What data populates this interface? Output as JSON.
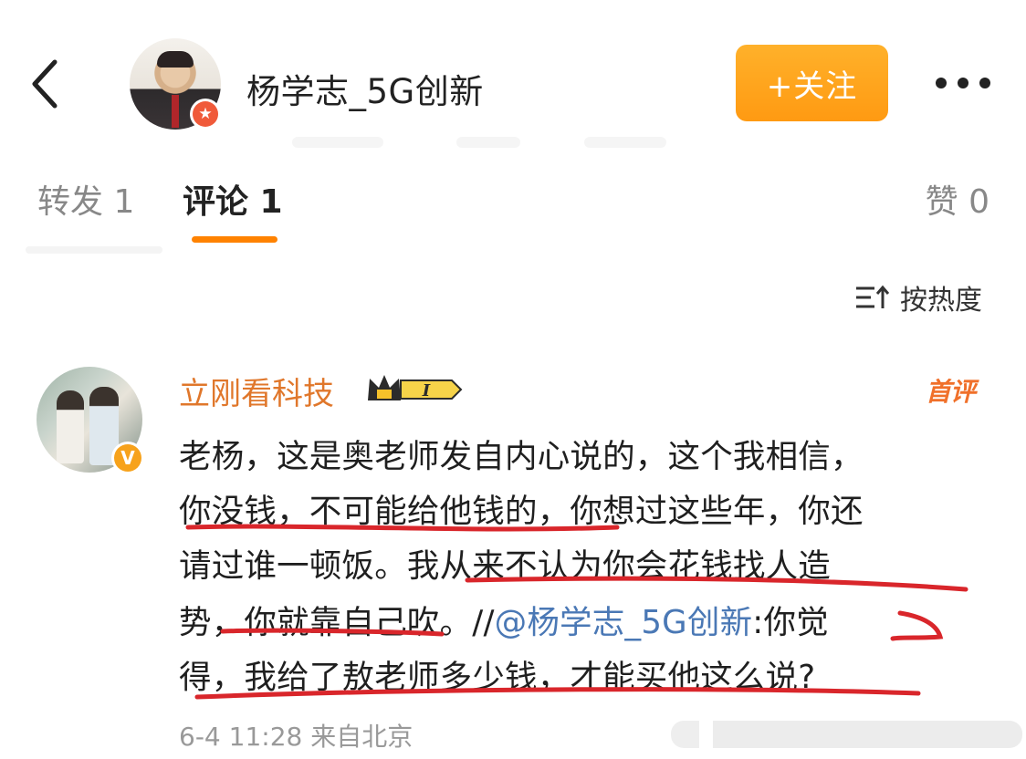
{
  "header": {
    "username": "杨学志_5G创新",
    "follow_label": "+关注"
  },
  "tabs": {
    "repost": "转发 1",
    "comment": "评论 1",
    "like": "赞 0"
  },
  "sort": {
    "label": "按热度"
  },
  "comment": {
    "user": "立刚看科技",
    "badge_level": "I",
    "first_badge": "首评",
    "verify_mark": "V",
    "line1": "老杨，这是奥老师发自内心说的，这个我相信，",
    "line2": "你没钱，不可能给他钱的，你想过这些年，你还",
    "line3": "请过谁一顿饭。我从来不认为你会花钱找人造",
    "line4_a": "势，你就靠自己吹。//",
    "line4_mention": "@杨学志_5G创新",
    "line4_b": ":你觉",
    "line5": "得，我给了敖老师多少钱，才能买他这么说?",
    "meta": "6-4 11:28 来自北京"
  },
  "colors": {
    "accent_orange": "#ff8200",
    "follow_button": "#ffa41b",
    "username_orange": "#e0772b",
    "mention_blue": "#4a78b5",
    "underline_red": "#d9262b"
  }
}
